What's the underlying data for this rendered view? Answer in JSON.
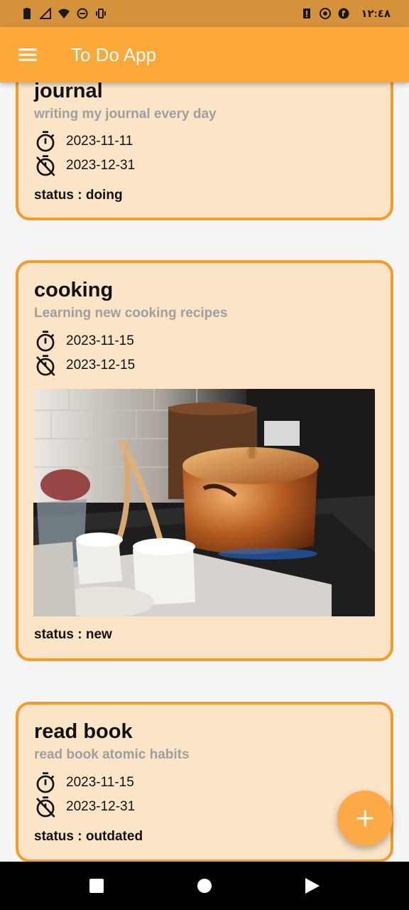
{
  "statusbar": {
    "time": "١٢:٤٨"
  },
  "appbar": {
    "title": "To Do App",
    "menu_icon": "menu-icon"
  },
  "tasks": [
    {
      "title": "journal",
      "description": "writing my journal every day",
      "start_date": "2023-11-11",
      "end_date": "2023-12-31",
      "status": "status : doing",
      "has_image": false
    },
    {
      "title": "cooking",
      "description": "Learning new cooking recipes",
      "start_date": "2023-11-15",
      "end_date": "2023-12-15",
      "status": "status : new",
      "has_image": true
    },
    {
      "title": "read book",
      "description": "read book atomic habits",
      "start_date": "2023-11-15",
      "end_date": "2023-12-31",
      "status": "status : outdated",
      "has_image": false
    }
  ],
  "fab": {
    "icon": "plus-icon"
  },
  "colors": {
    "appbar": "#fda93a",
    "statusbar": "#d4923a",
    "card_bg": "#fce4c7",
    "card_border": "#f79a26",
    "fab": "#fdaa47"
  }
}
